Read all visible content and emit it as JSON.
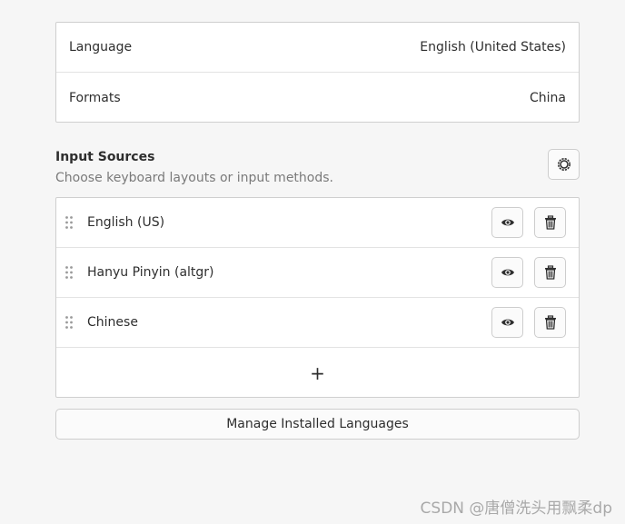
{
  "region": {
    "rows": [
      {
        "label": "Language",
        "value": "English (United States)"
      },
      {
        "label": "Formats",
        "value": "China"
      }
    ]
  },
  "input_sources": {
    "title": "Input Sources",
    "subtitle": "Choose keyboard layouts or input methods.",
    "options_icon": "gear-icon",
    "items": [
      {
        "name": "English (US)"
      },
      {
        "name": "Hanyu Pinyin (altgr)"
      },
      {
        "name": "Chinese"
      }
    ],
    "view_icon": "eye-icon",
    "remove_icon": "trash-icon",
    "add_icon": "plus-icon",
    "add_glyph": "+"
  },
  "manage_button_label": "Manage Installed Languages",
  "watermark": "CSDN @唐僧洗头用飘柔dp",
  "colors": {
    "background": "#f6f6f6",
    "panel": "#ffffff",
    "border": "#cfcfcf",
    "text": "#2e2e2e",
    "muted": "#7a7a7a"
  }
}
